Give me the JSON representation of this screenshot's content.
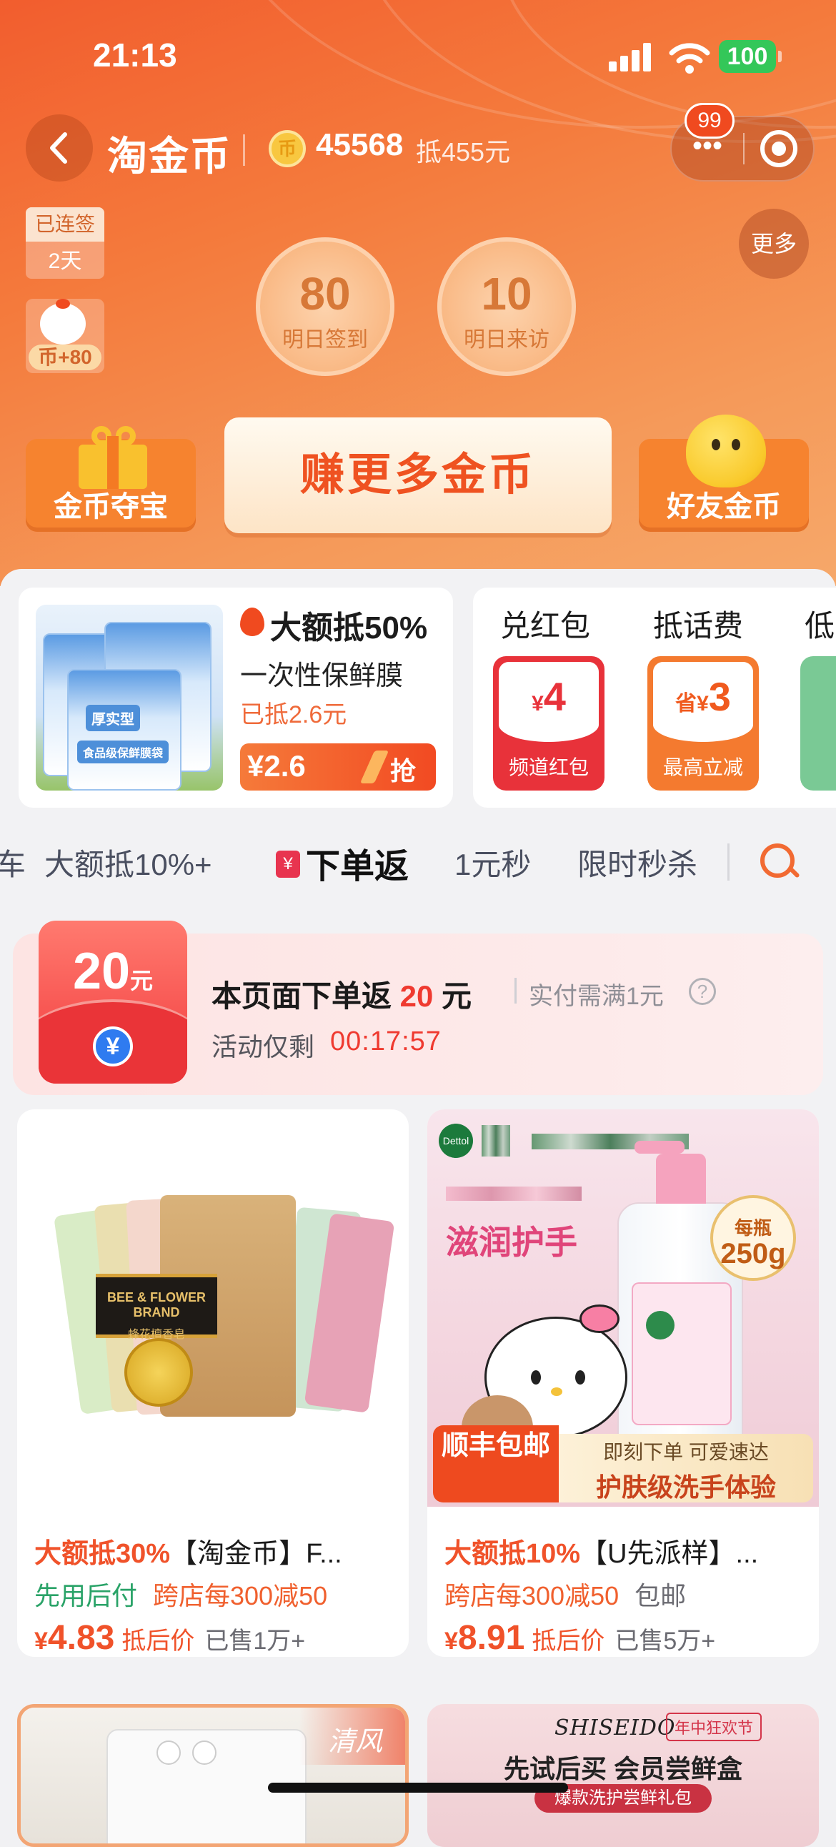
{
  "status_bar": {
    "time": "21:13",
    "battery": "100"
  },
  "header": {
    "brand": "淘金币",
    "coin_icon_label": "币",
    "coin_balance": "45568",
    "coin_deduct": "抵455元",
    "badge_count": "99",
    "capsule_dots": "•••"
  },
  "checkin": {
    "streak_label": "已连签",
    "streak_days": "2天",
    "chick_bonus": "币+80",
    "more_label": "更多",
    "tomorrow_sign": {
      "value": "80",
      "label": "明日签到"
    },
    "tomorrow_visit": {
      "value": "10",
      "label": "明日来访"
    }
  },
  "actions": {
    "treasure": "金币夺宝",
    "earn_more": "赚更多金币",
    "friends": "好友金币"
  },
  "promo": {
    "title": "大额抵50%",
    "product": "一次性保鲜膜",
    "deducted": "已抵2.6元",
    "price": "¥2.6",
    "grab": "抢",
    "pack_label_1": "厚实型",
    "pack_label_2": "食品级保鲜膜袋"
  },
  "redbag": {
    "exchange_title": "兑红包",
    "phone_title": "抵话费",
    "partial_title": "低",
    "card1": {
      "currency": "¥",
      "amount": "4",
      "caption": "频道红包",
      "color": "#e8323a"
    },
    "card2": {
      "prefix": "省¥",
      "amount": "3",
      "caption": "最高立减",
      "color": "#f47a2f"
    }
  },
  "tabs": [
    {
      "label": "大额抵10%+",
      "active": false
    },
    {
      "label": "下单返",
      "active": true,
      "icon": "¥"
    },
    {
      "label": "1元秒",
      "active": false
    },
    {
      "label": "限时秒杀",
      "active": false
    }
  ],
  "cashback": {
    "envelope_amount": "20",
    "envelope_unit": "元",
    "envelope_yen": "¥",
    "title_prefix": "本页面下单返 ",
    "title_amount": "20",
    "title_suffix": " 元",
    "condition": "实付需满1元",
    "help": "?",
    "remaining_label": "活动仅剩",
    "countdown": "00:17:57"
  },
  "products": [
    {
      "highlight": "大额抵30%",
      "name": "【淘金币】F...",
      "tags": [
        {
          "text": "先用后付",
          "color": "green"
        },
        {
          "text": "跨店每300减50",
          "color": "orange"
        }
      ],
      "price_yen": "¥",
      "price": "4.83",
      "after_label": "抵后价",
      "sold": "已售1万+",
      "image_text": "BEE & FLOWER BRAND",
      "image_subtext": "蜂花檀香皂"
    },
    {
      "highlight": "大额抵10%",
      "name": "【U先派样】...",
      "tags": [
        {
          "text": "跨店每300减50",
          "color": "orange"
        },
        {
          "text": "包邮",
          "color": "gray"
        }
      ],
      "price_yen": "¥",
      "price": "8.91",
      "after_label": "抵后价",
      "sold": "已售5万+",
      "logo": "Dettol",
      "headline": "滋润护手",
      "per_bottle": "每瓶",
      "volume": "250g",
      "sf_tag": "顺丰包邮",
      "order_now": "即刻下单 可爱速达",
      "skin_level": "护肤级洗手体验"
    }
  ],
  "next_row": {
    "left_brand": "清风",
    "right_brand": "SHISEIDO",
    "right_festival": "年中狂欢节",
    "right_headline": "先试后买 会员尝鲜盒",
    "right_sub": "爆款洗护尝鲜礼包"
  }
}
